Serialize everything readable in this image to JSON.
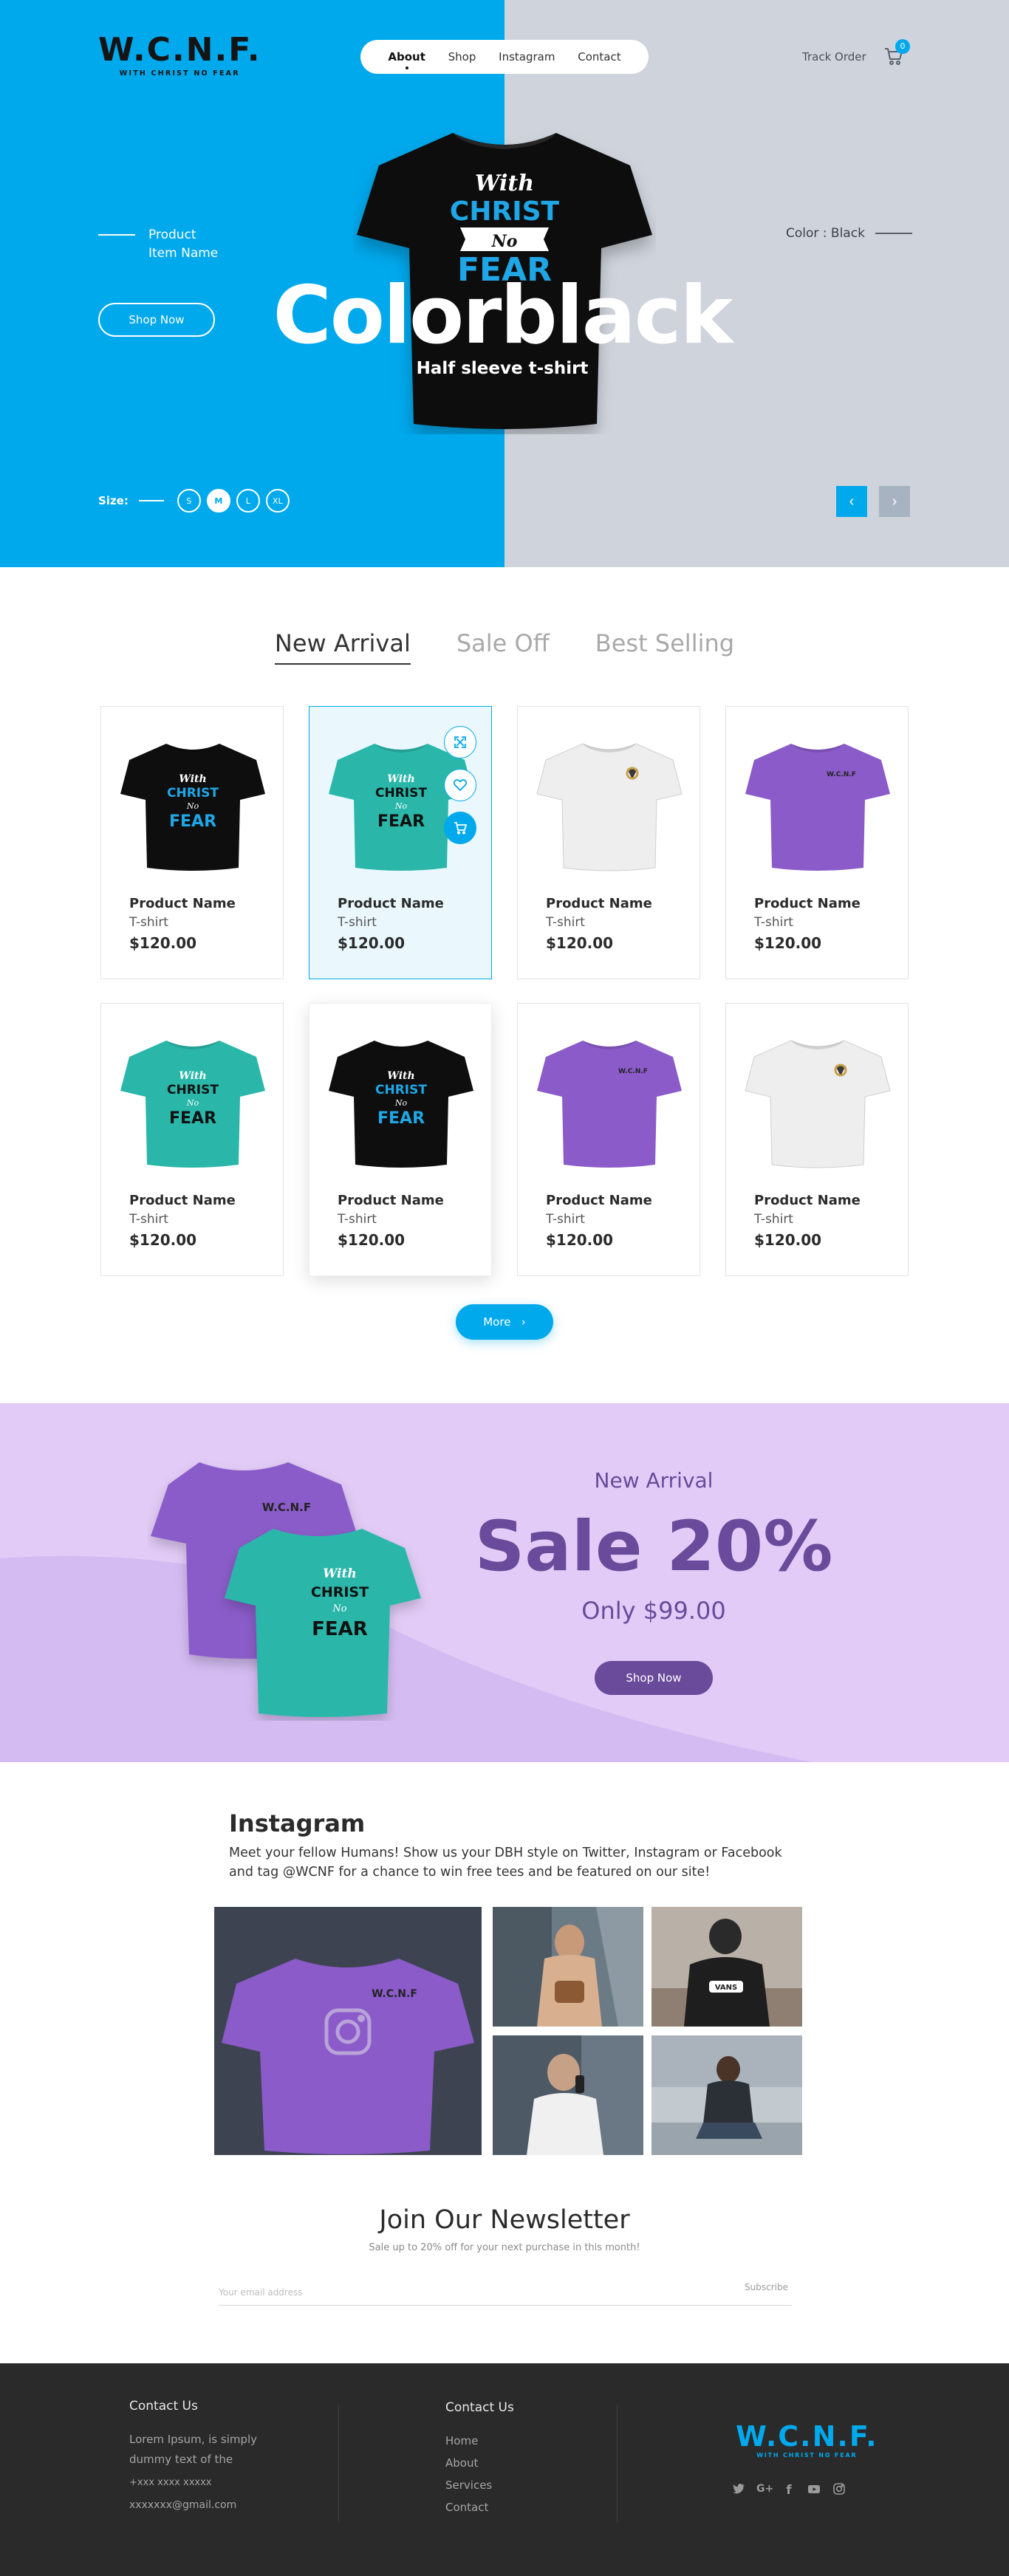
{
  "brand": {
    "logo": "W.C.N.F.",
    "tagline": "WITH CHRIST NO FEAR"
  },
  "nav": {
    "items": [
      "About",
      "Shop",
      "Instagram",
      "Contact"
    ],
    "active": 0
  },
  "header": {
    "track_order": "Track Order",
    "cart_count": "0"
  },
  "hero": {
    "product_label_1": "Product",
    "product_label_2": "Item Name",
    "color_label": "Color : Black",
    "title": "Colorblack",
    "subtitle": "Half sleeve t-shirt",
    "shop_now": "Shop Now",
    "size_label": "Size:",
    "sizes": [
      "S",
      "M",
      "L",
      "XL"
    ],
    "selected_size": "M",
    "prev_arrow": "‹",
    "next_arrow": "›",
    "shirt_text": [
      "With",
      "CHRIST",
      "No",
      "FEAR"
    ]
  },
  "tabs": [
    "New Arrival",
    "Sale Off",
    "Best Selling"
  ],
  "products": [
    {
      "name": "Product Name",
      "type": "T-shirt",
      "price": "$120.00",
      "color": "black"
    },
    {
      "name": "Product Name",
      "type": "T-shirt",
      "price": "$120.00",
      "color": "teal"
    },
    {
      "name": "Product Name",
      "type": "T-shirt",
      "price": "$120.00",
      "color": "white"
    },
    {
      "name": "Product Name",
      "type": "T-shirt",
      "price": "$120.00",
      "color": "purple"
    },
    {
      "name": "Product Name",
      "type": "T-shirt",
      "price": "$120.00",
      "color": "teal"
    },
    {
      "name": "Product Name",
      "type": "T-shirt",
      "price": "$120.00",
      "color": "black"
    },
    {
      "name": "Product Name",
      "type": "T-shirt",
      "price": "$120.00",
      "color": "purple"
    },
    {
      "name": "Product Name",
      "type": "T-shirt",
      "price": "$120.00",
      "color": "white"
    }
  ],
  "more_button": "More",
  "sale": {
    "label": "New Arrival",
    "headline": "Sale 20%",
    "price": "Only $99.00",
    "button": "Shop Now"
  },
  "instagram": {
    "title": "Instagram",
    "text": "Meet your fellow Humans! Show us your DBH style on Twitter, Instagram or Facebook and tag @WCNF for a chance to win free tees and be featured on our site!"
  },
  "newsletter": {
    "title": "Join Our Newsletter",
    "subtitle": "Sale up to 20% off for your next purchase in this month!",
    "placeholder": "Your email address",
    "button": "Subscribe"
  },
  "footer": {
    "col1_title": "Contact Us",
    "col1_text_1": "Lorem Ipsum, is simply",
    "col1_text_2": "dummy text of the",
    "phone": "+xxx xxxx xxxxx",
    "email": "xxxxxxx@gmail.com",
    "col2_title": "Contact Us",
    "links": [
      "Home",
      "About",
      "Services",
      "Contact"
    ],
    "social": [
      "twitter-icon",
      "google-plus-icon",
      "facebook-icon",
      "youtube-icon",
      "instagram-icon"
    ]
  },
  "colors": {
    "accent": "#00a8ec",
    "hero_right": "#cfd4dc",
    "purple": "#6a4a9a",
    "lavender": "#e2ccf7",
    "footer": "#2a2a2a",
    "teal": "#2ab7a9",
    "shirt_purple": "#8a5bc9"
  }
}
